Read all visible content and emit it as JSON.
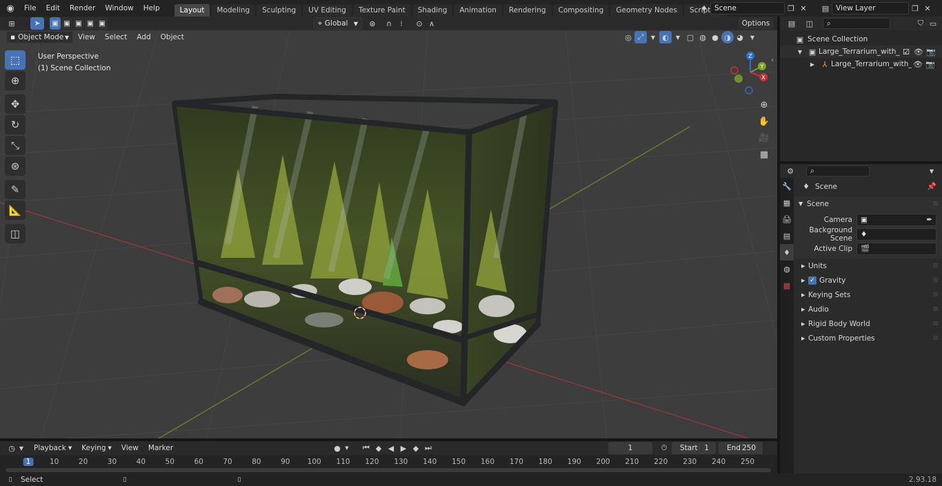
{
  "app": {
    "menus": [
      "File",
      "Edit",
      "Render",
      "Window",
      "Help"
    ],
    "workspaces": [
      {
        "label": "Layout",
        "active": true
      },
      {
        "label": "Modeling",
        "active": false
      },
      {
        "label": "Sculpting",
        "active": false
      },
      {
        "label": "UV Editing",
        "active": false
      },
      {
        "label": "Texture Paint",
        "active": false
      },
      {
        "label": "Shading",
        "active": false
      },
      {
        "label": "Animation",
        "active": false
      },
      {
        "label": "Rendering",
        "active": false
      },
      {
        "label": "Compositing",
        "active": false
      },
      {
        "label": "Geometry Nodes",
        "active": false
      },
      {
        "label": "Scripting",
        "active": false
      }
    ],
    "add_workspace": "+",
    "scene_name": "Scene",
    "view_layer": "View Layer"
  },
  "viewport": {
    "mode": "Object Mode",
    "menus": [
      "View",
      "Select",
      "Add",
      "Object"
    ],
    "orientation": "Global",
    "options_label": "Options",
    "overlay_text_1": "User Perspective",
    "overlay_text_2": "(1) Scene Collection",
    "gizmo": {
      "z": "Z",
      "y": "Y",
      "x": "X"
    }
  },
  "outliner": {
    "root": "Scene Collection",
    "items": [
      {
        "label": "Large_Terrarium_with_Plants_",
        "depth": 1
      },
      {
        "label": "Large_Terrarium_with_Pl",
        "depth": 2
      }
    ]
  },
  "properties": {
    "header": "Scene",
    "panel_title": "Scene",
    "fields": [
      {
        "label": "Camera",
        "value": ""
      },
      {
        "label": "Background Scene",
        "value": ""
      },
      {
        "label": "Active Clip",
        "value": ""
      }
    ],
    "sections": [
      "Units",
      "Gravity",
      "Keying Sets",
      "Audio",
      "Rigid Body World",
      "Custom Properties"
    ]
  },
  "timeline": {
    "menus": [
      "Playback",
      "Keying",
      "View",
      "Marker"
    ],
    "current_frame": "1",
    "start_label": "Start",
    "start_value": "1",
    "end_label": "End",
    "end_value": "250",
    "ruler": [
      "1",
      "10",
      "20",
      "30",
      "40",
      "50",
      "60",
      "70",
      "80",
      "90",
      "100",
      "110",
      "120",
      "130",
      "140",
      "150",
      "160",
      "170",
      "180",
      "190",
      "200",
      "210",
      "220",
      "230",
      "240",
      "250"
    ]
  },
  "status": {
    "left": "Select",
    "version": "2.93.18"
  },
  "colors": {
    "accent": "#4772b3",
    "axis_x": "#9b3a3a",
    "axis_y": "#6b8b2a"
  }
}
